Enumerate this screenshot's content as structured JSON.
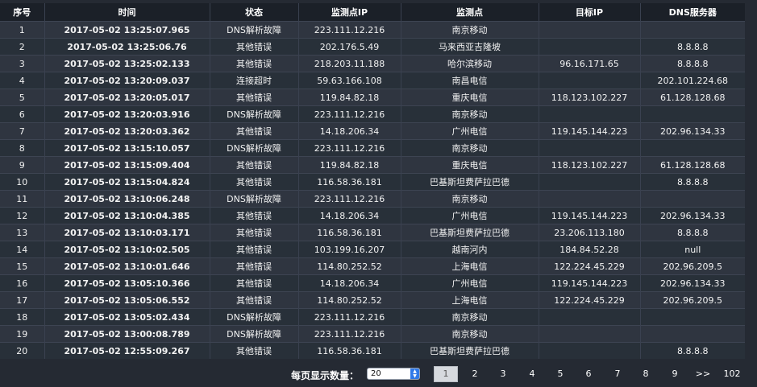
{
  "table": {
    "headers": [
      "序号",
      "时间",
      "状态",
      "监测点IP",
      "监测点",
      "目标IP",
      "DNS服务器"
    ],
    "rows": [
      [
        "1",
        "2017-05-02 13:25:07.965",
        "DNS解析故障",
        "223.111.12.216",
        "南京移动",
        "",
        ""
      ],
      [
        "2",
        "2017-05-02 13:25:06.76",
        "其他错误",
        "202.176.5.49",
        "马来西亚吉隆坡",
        "",
        "8.8.8.8"
      ],
      [
        "3",
        "2017-05-02 13:25:02.133",
        "其他错误",
        "218.203.11.188",
        "哈尔滨移动",
        "96.16.171.65",
        "8.8.8.8"
      ],
      [
        "4",
        "2017-05-02 13:20:09.037",
        "连接超时",
        "59.63.166.108",
        "南昌电信",
        "",
        "202.101.224.68"
      ],
      [
        "5",
        "2017-05-02 13:20:05.017",
        "其他错误",
        "119.84.82.18",
        "重庆电信",
        "118.123.102.227",
        "61.128.128.68"
      ],
      [
        "6",
        "2017-05-02 13:20:03.916",
        "DNS解析故障",
        "223.111.12.216",
        "南京移动",
        "",
        ""
      ],
      [
        "7",
        "2017-05-02 13:20:03.362",
        "其他错误",
        "14.18.206.34",
        "广州电信",
        "119.145.144.223",
        "202.96.134.33"
      ],
      [
        "8",
        "2017-05-02 13:15:10.057",
        "DNS解析故障",
        "223.111.12.216",
        "南京移动",
        "",
        ""
      ],
      [
        "9",
        "2017-05-02 13:15:09.404",
        "其他错误",
        "119.84.82.18",
        "重庆电信",
        "118.123.102.227",
        "61.128.128.68"
      ],
      [
        "10",
        "2017-05-02 13:15:04.824",
        "其他错误",
        "116.58.36.181",
        "巴基斯坦费萨拉巴德",
        "",
        "8.8.8.8"
      ],
      [
        "11",
        "2017-05-02 13:10:06.248",
        "DNS解析故障",
        "223.111.12.216",
        "南京移动",
        "",
        ""
      ],
      [
        "12",
        "2017-05-02 13:10:04.385",
        "其他错误",
        "14.18.206.34",
        "广州电信",
        "119.145.144.223",
        "202.96.134.33"
      ],
      [
        "13",
        "2017-05-02 13:10:03.171",
        "其他错误",
        "116.58.36.181",
        "巴基斯坦费萨拉巴德",
        "23.206.113.180",
        "8.8.8.8"
      ],
      [
        "14",
        "2017-05-02 13:10:02.505",
        "其他错误",
        "103.199.16.207",
        "越南河内",
        "184.84.52.28",
        "null"
      ],
      [
        "15",
        "2017-05-02 13:10:01.646",
        "其他错误",
        "114.80.252.52",
        "上海电信",
        "122.224.45.229",
        "202.96.209.5"
      ],
      [
        "16",
        "2017-05-02 13:05:10.366",
        "其他错误",
        "14.18.206.34",
        "广州电信",
        "119.145.144.223",
        "202.96.134.33"
      ],
      [
        "17",
        "2017-05-02 13:05:06.552",
        "其他错误",
        "114.80.252.52",
        "上海电信",
        "122.224.45.229",
        "202.96.209.5"
      ],
      [
        "18",
        "2017-05-02 13:05:02.434",
        "DNS解析故障",
        "223.111.12.216",
        "南京移动",
        "",
        ""
      ],
      [
        "19",
        "2017-05-02 13:00:08.789",
        "DNS解析故障",
        "223.111.12.216",
        "南京移动",
        "",
        ""
      ],
      [
        "20",
        "2017-05-02 12:55:09.267",
        "其他错误",
        "116.58.36.181",
        "巴基斯坦费萨拉巴德",
        "",
        "8.8.8.8"
      ]
    ]
  },
  "pager": {
    "page_size_label": "每页显示数量：",
    "page_size_value": "20",
    "current_page": "1",
    "pages": [
      "1",
      "2",
      "3",
      "4",
      "5",
      "6",
      "7",
      "8",
      "9"
    ],
    "next_label": ">>",
    "last_page": "102"
  },
  "colors": {
    "background": "#252a33",
    "header_bg": "#1b2028",
    "row_odd": "#2f3540",
    "row_even": "#283039",
    "select_arrow": "#2f79e8"
  }
}
